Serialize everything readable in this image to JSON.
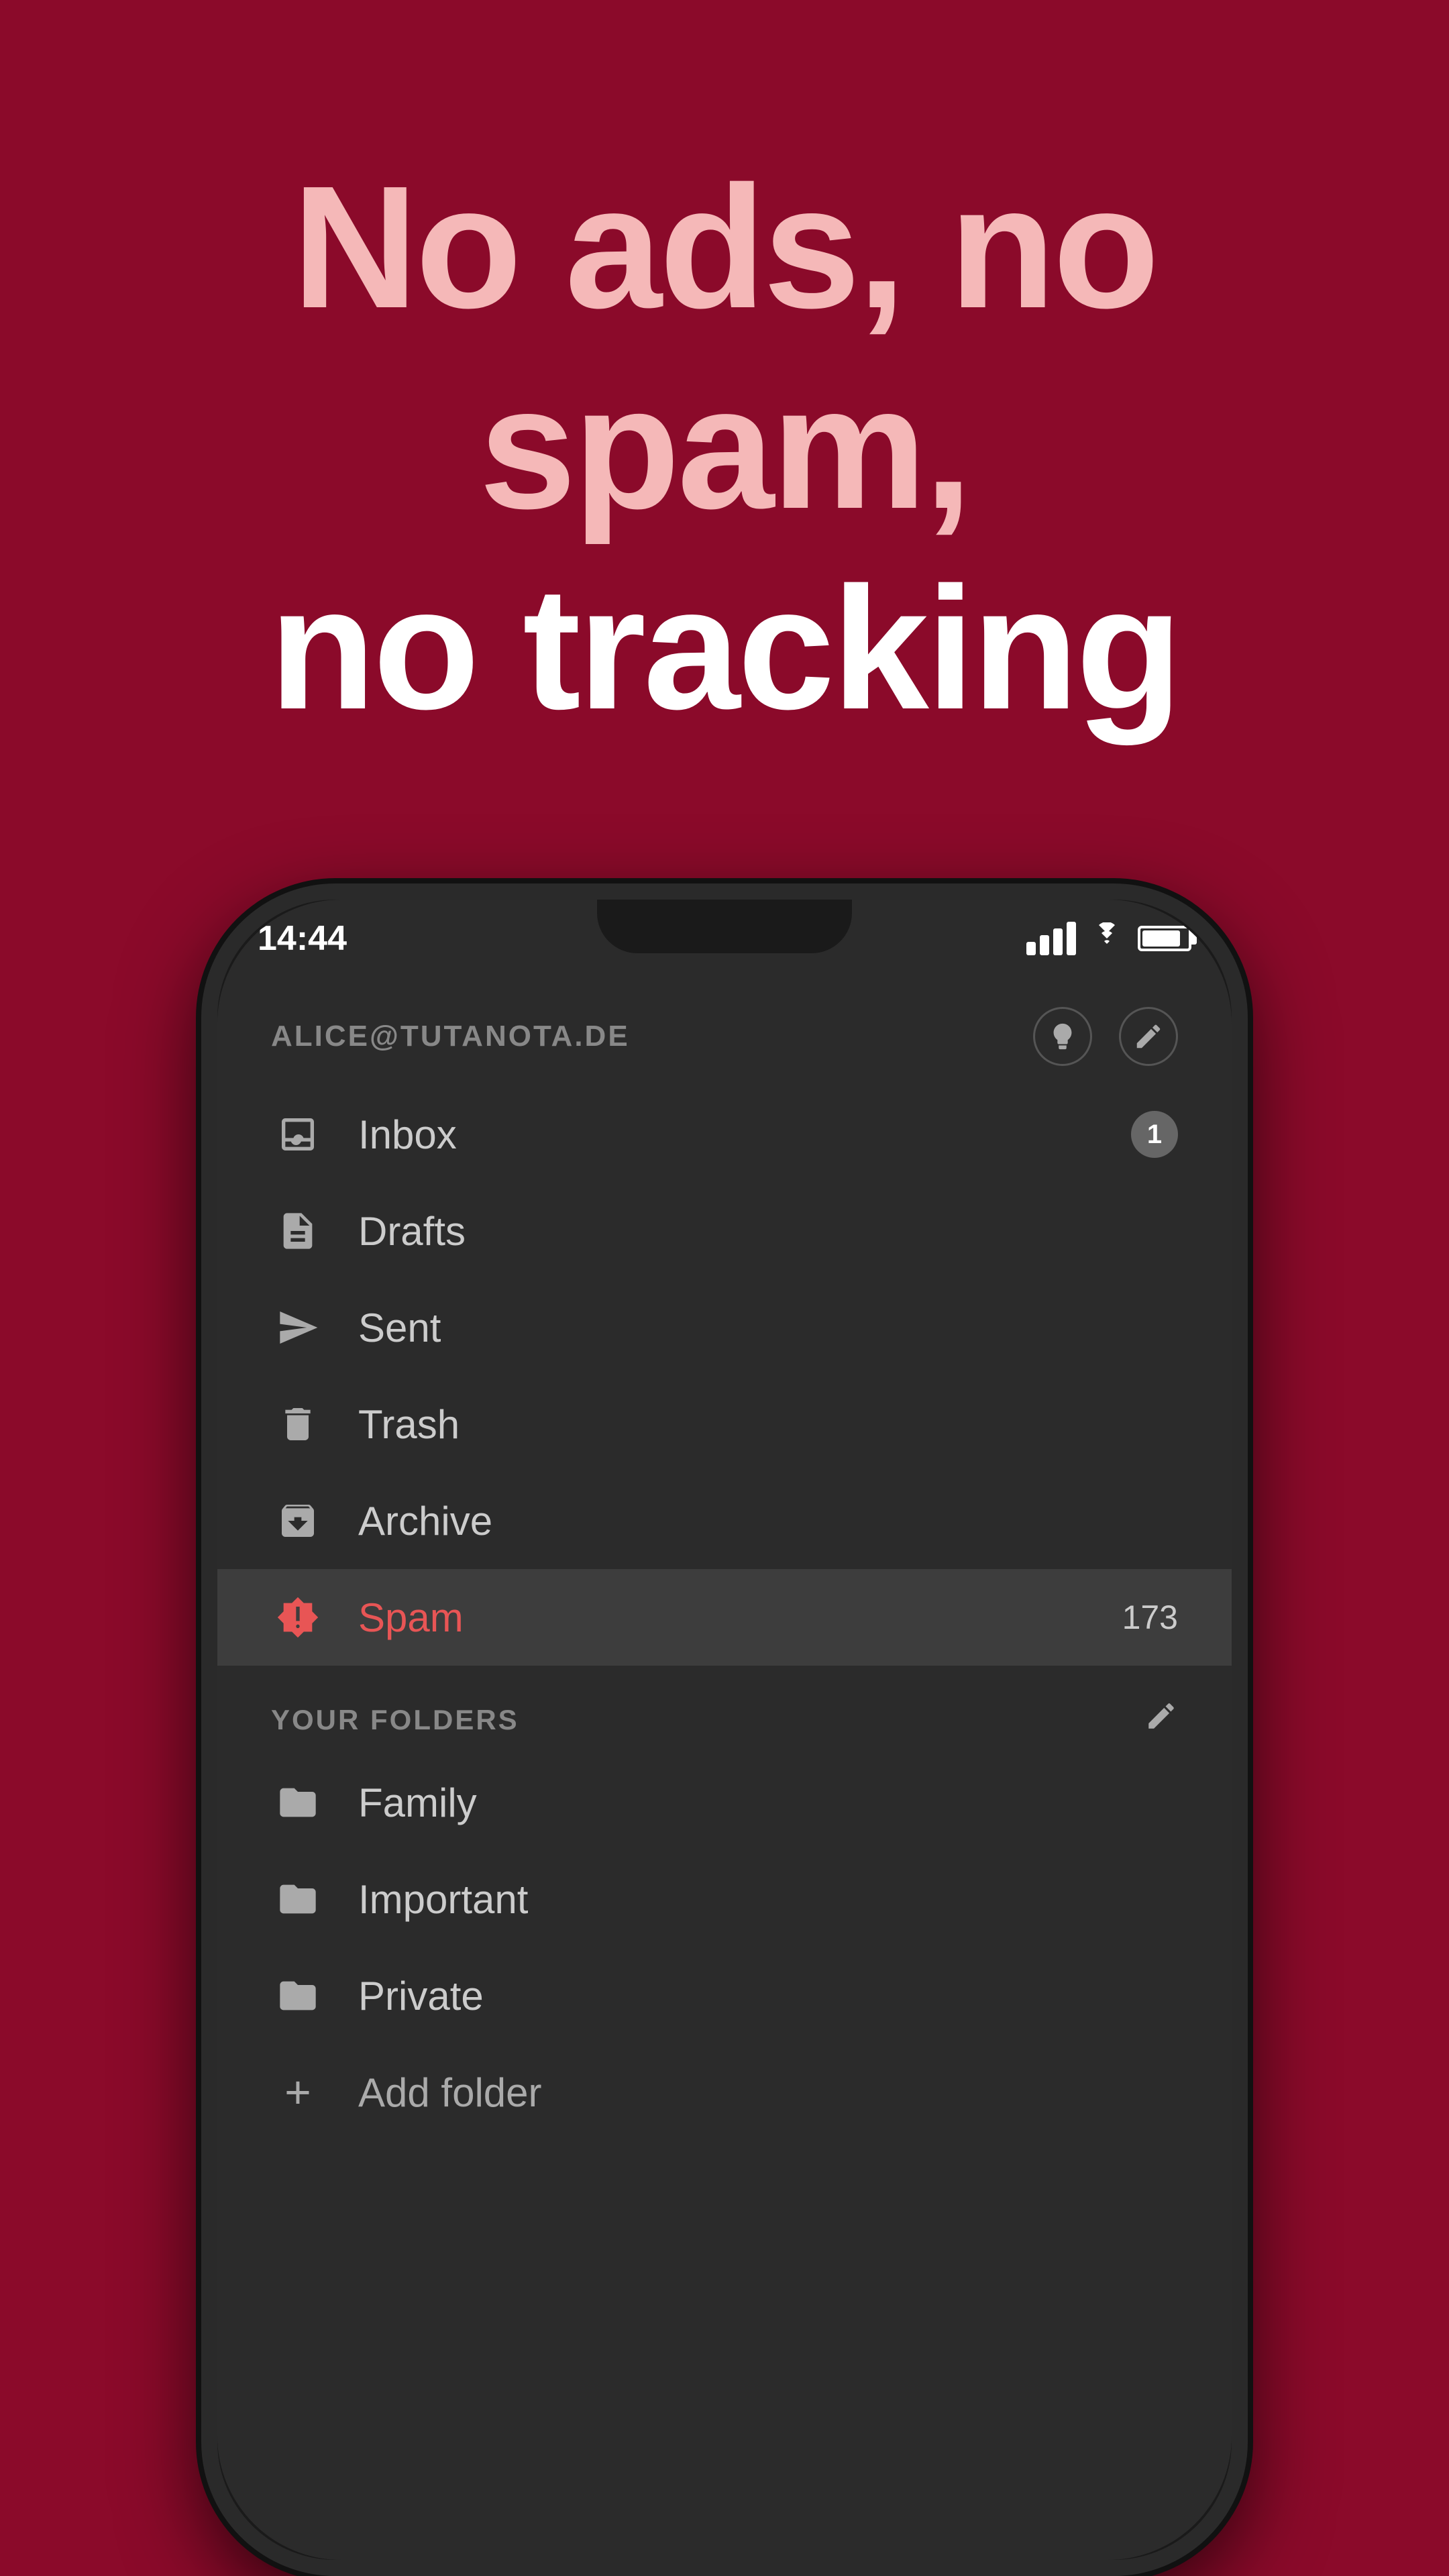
{
  "headline": {
    "line1": "No ads, no spam,",
    "line2": "no tracking"
  },
  "statusBar": {
    "time": "14:44",
    "signalBars": 4,
    "batteryLevel": 85
  },
  "account": {
    "email": "ALICE@TUTANOTA.DE"
  },
  "navItems": [
    {
      "id": "inbox",
      "label": "Inbox",
      "badge": "1",
      "count": null,
      "active": false
    },
    {
      "id": "drafts",
      "label": "Drafts",
      "badge": null,
      "count": null,
      "active": false
    },
    {
      "id": "sent",
      "label": "Sent",
      "badge": null,
      "count": null,
      "active": false
    },
    {
      "id": "trash",
      "label": "Trash",
      "badge": null,
      "count": null,
      "active": false
    },
    {
      "id": "archive",
      "label": "Archive",
      "badge": null,
      "count": null,
      "active": false
    },
    {
      "id": "spam",
      "label": "Spam",
      "badge": null,
      "count": "173",
      "active": true
    }
  ],
  "foldersSection": {
    "label": "YOUR FOLDERS"
  },
  "folders": [
    {
      "id": "family",
      "label": "Family"
    },
    {
      "id": "important",
      "label": "Important"
    },
    {
      "id": "private",
      "label": "Private"
    }
  ],
  "addFolder": {
    "label": "Add folder"
  }
}
